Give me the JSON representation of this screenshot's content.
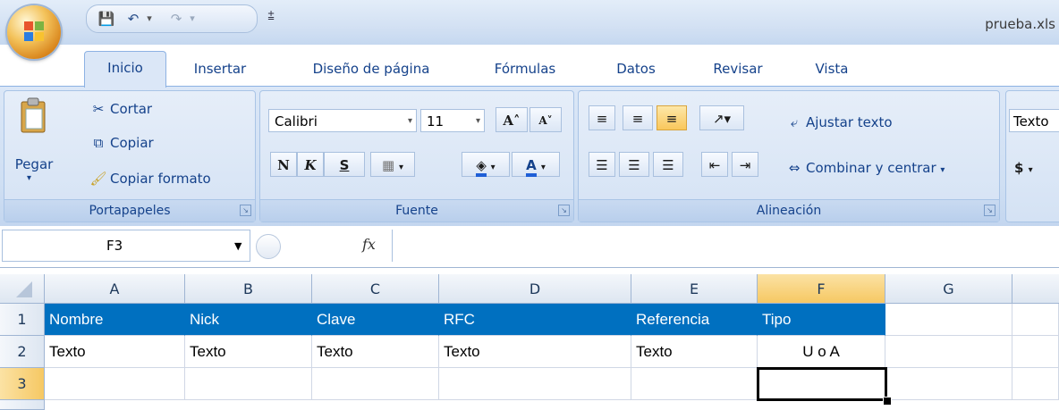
{
  "window": {
    "title": "prueba.xls"
  },
  "qat": {
    "save": "💾",
    "undo": "↶",
    "undo_dd": "▾",
    "redo": "↷",
    "redo_dd": "▾",
    "customize": "⩲"
  },
  "tabs": [
    "Inicio",
    "Insertar",
    "Diseño de página",
    "Fórmulas",
    "Datos",
    "Revisar",
    "Vista"
  ],
  "clipboard": {
    "paste": "Pegar",
    "cut": "Cortar",
    "copy": "Copiar",
    "format_painter": "Copiar formato",
    "label": "Portapapeles"
  },
  "font": {
    "name": "Calibri",
    "size": "11",
    "grow": "A˄",
    "shrink": "A˅",
    "bold": "N",
    "italic": "K",
    "underline": "S",
    "label": "Fuente"
  },
  "alignment": {
    "wrap": "Ajustar texto",
    "merge": "Combinar y centrar",
    "label": "Alineación"
  },
  "number": {
    "format": "Texto",
    "currency": "$"
  },
  "formula_bar": {
    "name_box": "F3",
    "fx": "fx",
    "value": ""
  },
  "columns": [
    "A",
    "B",
    "C",
    "D",
    "E",
    "F",
    "G"
  ],
  "rows": [
    {
      "num": "1",
      "cells": [
        "Nombre",
        "Nick",
        "Clave",
        "RFC",
        "Referencia",
        "Tipo",
        ""
      ]
    },
    {
      "num": "2",
      "cells": [
        "Texto",
        "Texto",
        "Texto",
        "Texto",
        "Texto",
        "U o A",
        ""
      ]
    },
    {
      "num": "3",
      "cells": [
        "",
        "",
        "",
        "",
        "",
        "",
        ""
      ]
    }
  ],
  "selected_cell": "F3",
  "colors": {
    "header_fill": "#0070c0",
    "selection": "#000000",
    "ribbon": "#dbe7f7"
  }
}
